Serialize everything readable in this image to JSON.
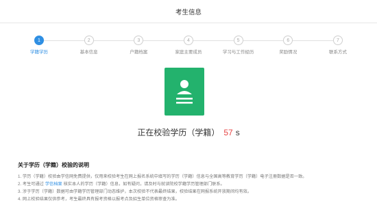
{
  "header": {
    "title": "考生信息"
  },
  "stepper": {
    "steps": [
      {
        "number": "1",
        "label": "学籍学历"
      },
      {
        "number": "2",
        "label": "基本信息"
      },
      {
        "number": "3",
        "label": "户籍档案"
      },
      {
        "number": "4",
        "label": "家庭主要成员"
      },
      {
        "number": "5",
        "label": "学习与工作经历"
      },
      {
        "number": "6",
        "label": "奖励情况"
      },
      {
        "number": "7",
        "label": "联系方式"
      }
    ],
    "active_index": 0,
    "active_color": "#2f8fe3"
  },
  "document_icon": {
    "name": "document-icon",
    "color": "#23b26d"
  },
  "status": {
    "text": "正在校验学历（学籍）",
    "seconds": "57",
    "unit": "s",
    "seconds_color": "#e64545"
  },
  "notes": {
    "title": "关于学历（学籍）校验的说明",
    "items": [
      {
        "text": "1. 学历（学籍）校验由学信网免费提供，仅用来校验考生在网上报名系统中填写的学历（学籍）信息与全国高等教育学历（学籍）电子注册数据是否一致。"
      },
      {
        "before": "2. 考生可通过",
        "link": "学信档案",
        "after": "核实本人的学历（学籍）信息，如有疑问，请及时与就读院校学籍学历管理部门联系。"
      },
      {
        "text": "3. 涉于学历（学籍）数据可由学籍学历管理部门动态维护，本次校验不代表最终结果，校验结果在网报系统开放期间均有效。"
      },
      {
        "text": "4. 网上校验结果仅供参考，考生最终具有报考资格以报考点及招生单位资格审查为准。"
      }
    ]
  }
}
